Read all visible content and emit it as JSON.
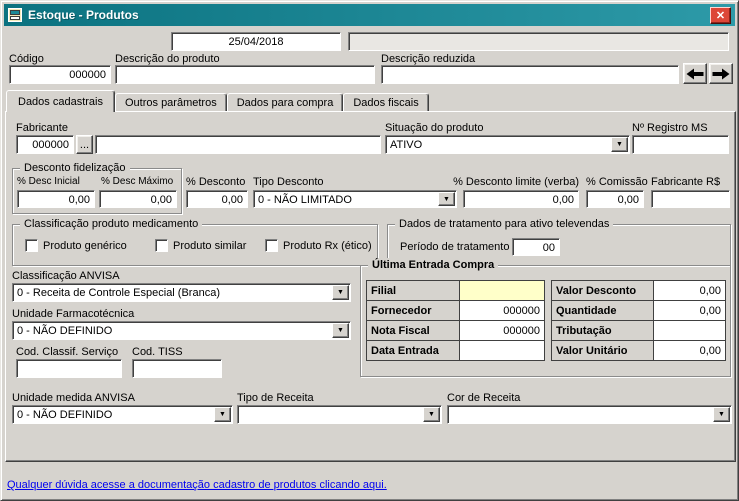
{
  "window": {
    "title": "Estoque - Produtos"
  },
  "icons": {
    "dropdown": "▼",
    "close": "✕"
  },
  "header": {
    "date_value": "25/04/2018",
    "info_value": "",
    "codigo_label": "Código",
    "codigo_value": "000000",
    "descricao_label": "Descrição do produto",
    "descricao_value": "",
    "reduzida_label": "Descrição reduzida",
    "reduzida_value": ""
  },
  "tabs": [
    {
      "label": "Dados cadastrais",
      "active": true
    },
    {
      "label": "Outros parâmetros",
      "active": false
    },
    {
      "label": "Dados para compra",
      "active": false
    },
    {
      "label": "Dados fiscais",
      "active": false
    }
  ],
  "main": {
    "fabricante_label": "Fabricante",
    "fabricante_code": "000000",
    "fabricante_browse": "...",
    "fabricante_name": "",
    "situacao_label": "Situação do produto",
    "situacao_value": "ATIVO",
    "registro_ms_label": "Nº Registro MS",
    "registro_ms_value": "",
    "desconto_fidelizacao": {
      "title": "Desconto fidelização",
      "desc_inicial_label": "% Desc Inicial",
      "desc_inicial_value": "0,00",
      "desc_maximo_label": "% Desc Máximo",
      "desc_maximo_value": "0,00"
    },
    "desconto_label": "% Desconto",
    "desconto_value": "0,00",
    "tipo_desconto_label": "Tipo Desconto",
    "tipo_desconto_value": "0 - NÃO LIMITADO",
    "desconto_limite_label": "% Desconto limite (verba)",
    "desconto_limite_value": "0,00",
    "comissao_label": "% Comissão",
    "comissao_value": "0,00",
    "fabricante_rs_label": "Fabricante R$",
    "fabricante_rs_value": "",
    "classificacao_medicamento": {
      "title": "Classificação produto medicamento",
      "checkboxes": [
        {
          "label": "Produto genérico",
          "checked": false
        },
        {
          "label": "Produto similar",
          "checked": false
        },
        {
          "label": "Produto Rx (ético)",
          "checked": false
        }
      ]
    },
    "televendas": {
      "title": "Dados de tratamento para ativo televendas",
      "periodo_label": "Período de tratamento",
      "periodo_value": "00"
    },
    "classificacao_anvisa_label": "Classificação ANVISA",
    "classificacao_anvisa_value": "0 - Receita de Controle Especial (Branca)",
    "unidade_farmacotecnica_label": "Unidade Farmacotécnica",
    "unidade_farmacotecnica_value": "0 - NÃO DEFINIDO",
    "cod_classif_label": "Cod. Classif. Serviço",
    "cod_classif_value": "",
    "cod_tiss_label": "Cod. TISS",
    "cod_tiss_value": "",
    "ultima_entrada": {
      "title": "Última Entrada Compra",
      "left_rows": [
        {
          "label": "Filial",
          "value": ""
        },
        {
          "label": "Fornecedor",
          "value": "000000"
        },
        {
          "label": "Nota Fiscal",
          "value": "000000"
        },
        {
          "label": "Data Entrada",
          "value": ""
        }
      ],
      "right_rows": [
        {
          "label": "Valor Desconto",
          "value": "0,00"
        },
        {
          "label": "Quantidade",
          "value": "0,00"
        },
        {
          "label": "Tributação",
          "value": ""
        },
        {
          "label": "Valor Unitário",
          "value": "0,00"
        }
      ]
    },
    "unidade_medida_label": "Unidade medida ANVISA",
    "unidade_medida_value": "0 - NÃO DEFINIDO",
    "tipo_receita_label": "Tipo de Receita",
    "tipo_receita_value": "",
    "cor_receita_label": "Cor de Receita",
    "cor_receita_value": ""
  },
  "footer": {
    "link_text": "Qualquer dúvida acesse a documentação cadastro de produtos clicando aqui."
  },
  "colors": {
    "titlebar": "#0b7280",
    "close_button": "#dd4738",
    "window_bg": "#d6d3ce",
    "filial_highlight": "#ffffc9",
    "link": "#0000ee"
  }
}
